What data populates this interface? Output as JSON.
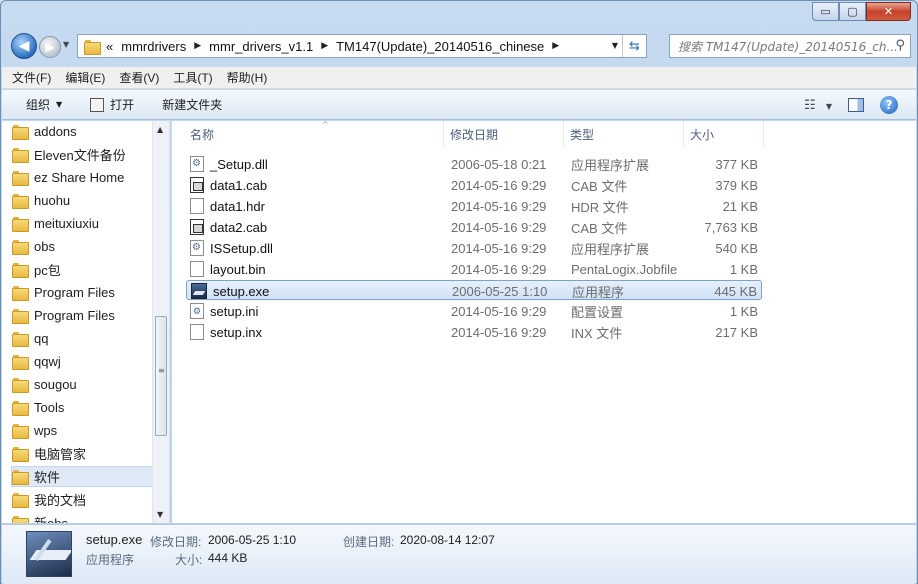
{
  "window": {
    "caption_buttons": {
      "minimize": "▭",
      "maximize": "▢",
      "close": "✕"
    }
  },
  "nav": {
    "back_glyph": "◀",
    "forward_glyph": "▶",
    "breadcrumb_overflow": "«",
    "breadcrumbs": [
      "mmrdrivers",
      "mmr_drivers_v1.1",
      "TM147(Update)_20140516_chinese"
    ],
    "search_placeholder": "搜索 TM147(Update)_20140516_ch...",
    "icons": {
      "back": "back-arrow-icon",
      "forward": "forward-arrow-icon",
      "refresh": "refresh-icon",
      "search": "search-icon"
    }
  },
  "menu": {
    "items": [
      "文件(F)",
      "编辑(E)",
      "查看(V)",
      "工具(T)",
      "帮助(H)"
    ]
  },
  "toolbar": {
    "organize": "组织",
    "open": "打开",
    "new_folder": "新建文件夹",
    "help": "?"
  },
  "sidebar": {
    "items": [
      {
        "label": "addons",
        "selected": false
      },
      {
        "label": "Eleven文件备份",
        "selected": false
      },
      {
        "label": "ez Share Home",
        "selected": false
      },
      {
        "label": "huohu",
        "selected": false
      },
      {
        "label": "meituxiuxiu",
        "selected": false
      },
      {
        "label": "obs",
        "selected": false
      },
      {
        "label": "pc包",
        "selected": false
      },
      {
        "label": "Program Files",
        "selected": false
      },
      {
        "label": "Program Files",
        "selected": false
      },
      {
        "label": "qq",
        "selected": false
      },
      {
        "label": "qqwj",
        "selected": false
      },
      {
        "label": "sougou",
        "selected": false
      },
      {
        "label": "Tools",
        "selected": false
      },
      {
        "label": "wps",
        "selected": false
      },
      {
        "label": "电脑管家",
        "selected": false
      },
      {
        "label": "软件",
        "selected": true
      },
      {
        "label": "我的文档",
        "selected": false
      },
      {
        "label": "新obs",
        "selected": false
      }
    ]
  },
  "file_list": {
    "columns": {
      "name": "名称",
      "date": "修改日期",
      "type": "类型",
      "size": "大小"
    },
    "files": [
      {
        "name": "_Setup.dll",
        "date": "2006-05-18 0:21",
        "type": "应用程序扩展",
        "size": "377 KB",
        "icon": "gear",
        "selected": false
      },
      {
        "name": "data1.cab",
        "date": "2014-05-16 9:29",
        "type": "CAB 文件",
        "size": "379 KB",
        "icon": "cab",
        "selected": false
      },
      {
        "name": "data1.hdr",
        "date": "2014-05-16 9:29",
        "type": "HDR 文件",
        "size": "21 KB",
        "icon": "blank",
        "selected": false
      },
      {
        "name": "data2.cab",
        "date": "2014-05-16 9:29",
        "type": "CAB 文件",
        "size": "7,763 KB",
        "icon": "cab",
        "selected": false
      },
      {
        "name": "ISSetup.dll",
        "date": "2014-05-16 9:29",
        "type": "应用程序扩展",
        "size": "540 KB",
        "icon": "gear",
        "selected": false
      },
      {
        "name": "layout.bin",
        "date": "2014-05-16 9:29",
        "type": "PentaLogix.Jobfile",
        "size": "1 KB",
        "icon": "blank",
        "selected": false
      },
      {
        "name": "setup.exe",
        "date": "2006-05-25 1:10",
        "type": "应用程序",
        "size": "445 KB",
        "icon": "exe",
        "selected": true
      },
      {
        "name": "setup.ini",
        "date": "2014-05-16 9:29",
        "type": "配置设置",
        "size": "1 KB",
        "icon": "ini",
        "selected": false
      },
      {
        "name": "setup.inx",
        "date": "2014-05-16 9:29",
        "type": "INX 文件",
        "size": "217 KB",
        "icon": "blank",
        "selected": false
      }
    ]
  },
  "details": {
    "file_name": "setup.exe",
    "file_kind": "应用程序",
    "modified_label": "修改日期:",
    "modified_value": "2006-05-25 1:10",
    "created_label": "创建日期:",
    "created_value": "2020-08-14 12:07",
    "size_label": "大小:",
    "size_value": "444 KB"
  }
}
